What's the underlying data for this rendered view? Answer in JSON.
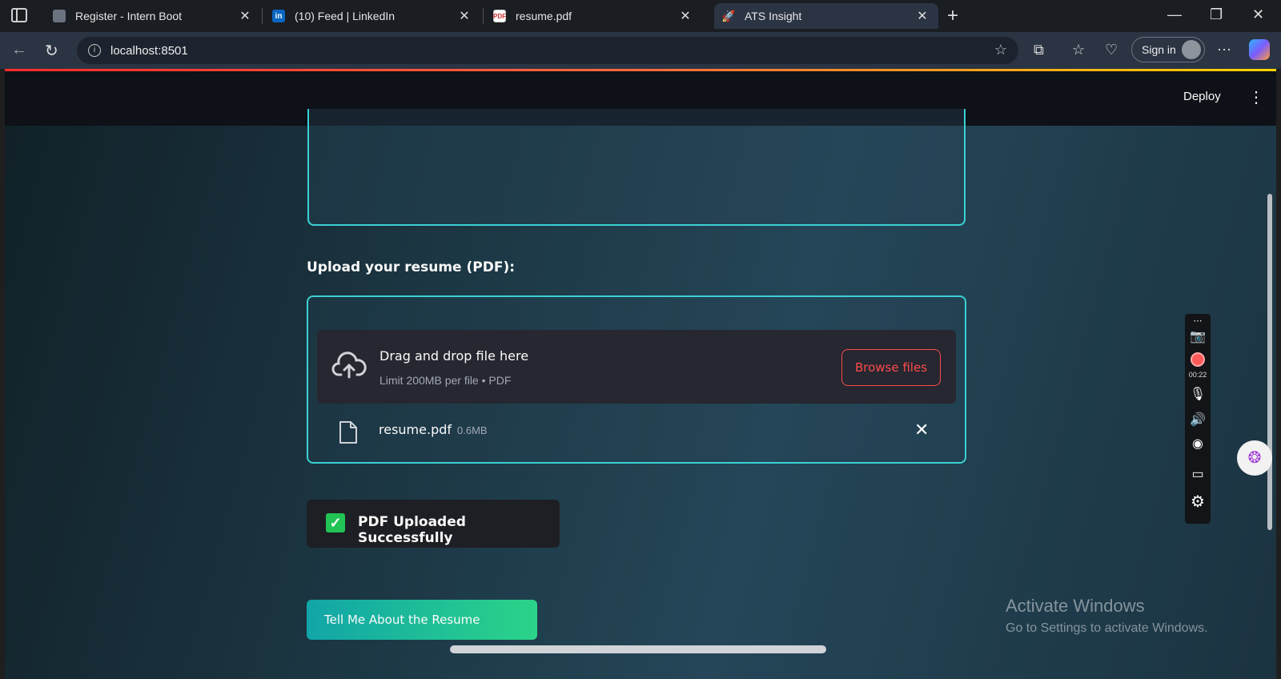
{
  "browser": {
    "tabs": [
      {
        "label": "Register - Intern Boot",
        "favicon": "document-icon",
        "active": false
      },
      {
        "label": "(10) Feed | LinkedIn",
        "favicon": "linkedin-icon",
        "favicon_text": "in",
        "active": false
      },
      {
        "label": "resume.pdf",
        "favicon": "pdf-icon",
        "favicon_text": "PDF",
        "active": false
      },
      {
        "label": "ATS Insight",
        "favicon": "rocket-icon",
        "active": true
      }
    ],
    "url": "localhost:8501",
    "signin_label": "Sign in"
  },
  "app": {
    "deploy_label": "Deploy",
    "upload_label": "Upload your resume (PDF):",
    "dropzone": {
      "title": "Drag and drop file here",
      "limit": "Limit 200MB per file • PDF",
      "browse_label": "Browse files"
    },
    "file": {
      "name": "resume.pdf",
      "size": "0.6MB"
    },
    "success_message": "PDF Uploaded Successfully",
    "action_button": "Tell Me About the Resume"
  },
  "recorder": {
    "timer": "00:22"
  },
  "watermark": {
    "title": "Activate Windows",
    "subtitle": "Go to Settings to activate Windows."
  },
  "colors": {
    "accent_teal": "#3ad1d4",
    "streamlit_red": "#ff4b4b",
    "success_green": "#21c354"
  }
}
